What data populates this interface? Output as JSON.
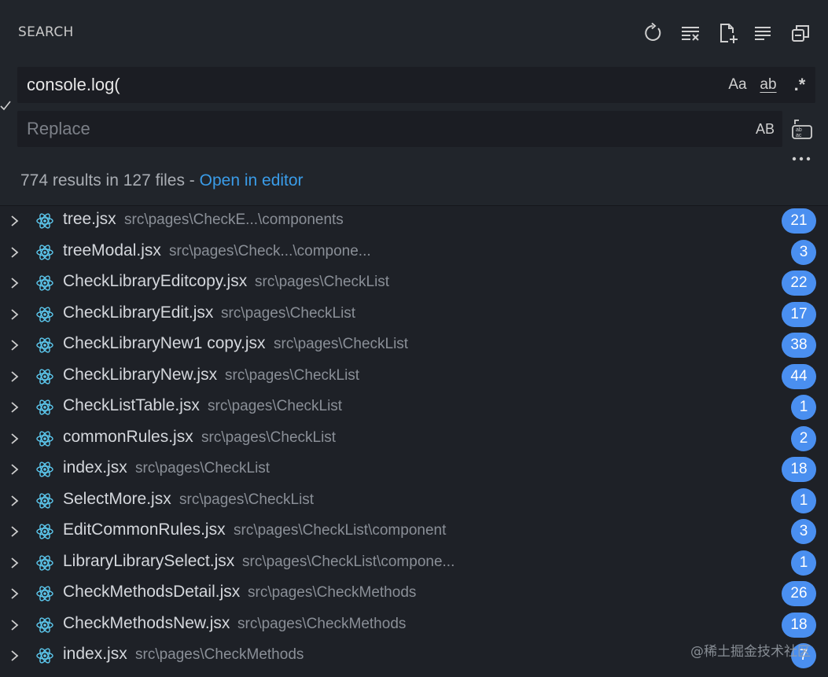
{
  "panel": {
    "title": "SEARCH",
    "actions": [
      {
        "name": "refresh",
        "icon": "refresh-icon"
      },
      {
        "name": "clear-results",
        "icon": "clear-all-icon"
      },
      {
        "name": "new-search-editor",
        "icon": "new-file-icon"
      },
      {
        "name": "view-as-tree",
        "icon": "list-icon"
      },
      {
        "name": "collapse-all",
        "icon": "collapse-all-icon"
      }
    ]
  },
  "search": {
    "value": "console.log(",
    "options": {
      "match_case": "Aa",
      "whole_word": "ab",
      "regex": ".*"
    }
  },
  "replace": {
    "placeholder": "Replace",
    "preserve_case": "AB",
    "replace_all_icon": "replace-all-icon"
  },
  "summary": {
    "text": "774 results in 127 files - ",
    "link": "Open in editor"
  },
  "results": [
    {
      "file": "tree.jsx",
      "path": "src\\pages\\CheckE...\\components",
      "count": "21"
    },
    {
      "file": "treeModal.jsx",
      "path": "src\\pages\\Check...\\compone...",
      "count": "3"
    },
    {
      "file": "CheckLibraryEditcopy.jsx",
      "path": "src\\pages\\CheckList",
      "count": "22"
    },
    {
      "file": "CheckLibraryEdit.jsx",
      "path": "src\\pages\\CheckList",
      "count": "17"
    },
    {
      "file": "CheckLibraryNew1 copy.jsx",
      "path": "src\\pages\\CheckList",
      "count": "38"
    },
    {
      "file": "CheckLibraryNew.jsx",
      "path": "src\\pages\\CheckList",
      "count": "44"
    },
    {
      "file": "CheckListTable.jsx",
      "path": "src\\pages\\CheckList",
      "count": "1"
    },
    {
      "file": "commonRules.jsx",
      "path": "src\\pages\\CheckList",
      "count": "2"
    },
    {
      "file": "index.jsx",
      "path": "src\\pages\\CheckList",
      "count": "18"
    },
    {
      "file": "SelectMore.jsx",
      "path": "src\\pages\\CheckList",
      "count": "1"
    },
    {
      "file": "EditCommonRules.jsx",
      "path": "src\\pages\\CheckList\\component",
      "count": "3"
    },
    {
      "file": "LibraryLibrarySelect.jsx",
      "path": "src\\pages\\CheckList\\compone...",
      "count": "1"
    },
    {
      "file": "CheckMethodsDetail.jsx",
      "path": "src\\pages\\CheckMethods",
      "count": "26"
    },
    {
      "file": "CheckMethodsNew.jsx",
      "path": "src\\pages\\CheckMethods",
      "count": "18"
    },
    {
      "file": "index.jsx",
      "path": "src\\pages\\CheckMethods",
      "count": "7"
    }
  ],
  "watermark": "@稀土掘金技术社区",
  "colors": {
    "badge": "#4a8ff0",
    "link": "#3a9ce8",
    "react": "#5cc8ee"
  }
}
